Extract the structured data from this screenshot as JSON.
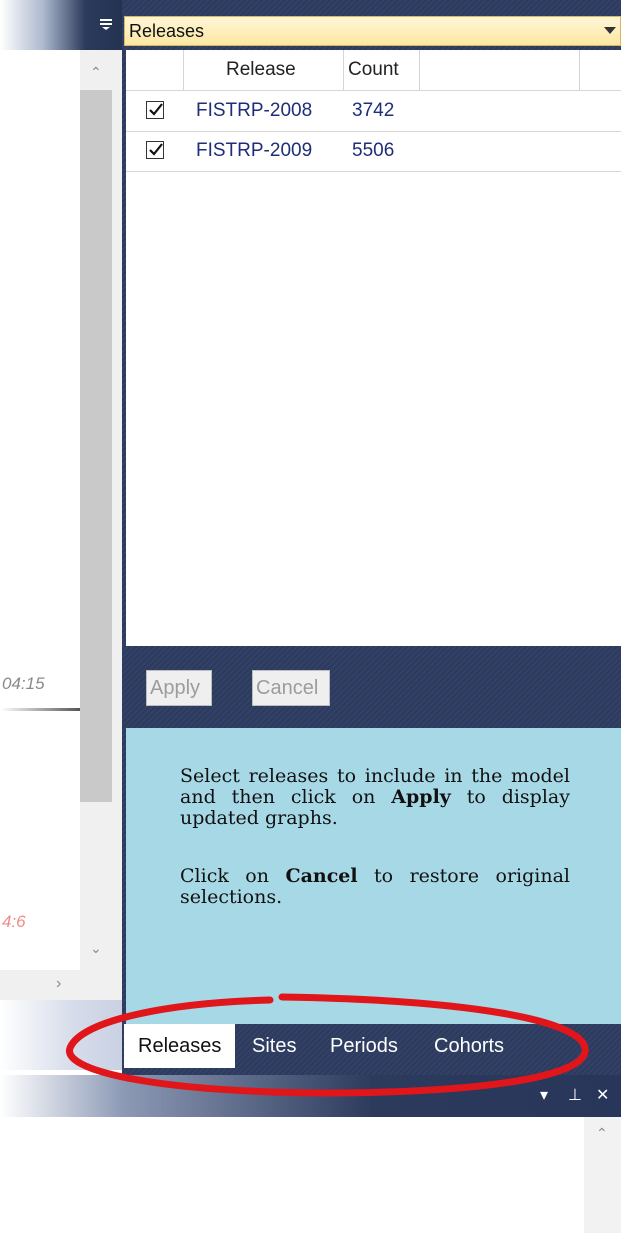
{
  "left": {
    "time_fragment_1": "04:15",
    "time_fragment_2": "4:6"
  },
  "panel": {
    "dropdown_value": "Releases",
    "grid": {
      "columns": [
        "Release",
        "Count"
      ],
      "rows": [
        {
          "checked": true,
          "release": "FISTRP-2008",
          "count": "3742"
        },
        {
          "checked": true,
          "release": "FISTRP-2009",
          "count": "5506"
        }
      ]
    },
    "buttons": {
      "apply": "Apply",
      "cancel": "Cancel"
    },
    "help": {
      "p1_text": "Select releases to include in the model and then click on ",
      "p1_bold": "Apply",
      "p1_tail": " to display updated graphs.",
      "p2_head": "Click on ",
      "p2_bold": "Cancel",
      "p2_tail": " to restore original selections."
    },
    "tabs": [
      "Releases",
      "Sites",
      "Periods",
      "Cohorts"
    ],
    "active_tab": "Releases"
  },
  "colors": {
    "panel_bg": "#2b3a5e",
    "dropdown_bg": "#fde7a2",
    "help_bg": "#a7d8e6",
    "link_text": "#1f2d7a",
    "highlight_ellipse": "#e0161b"
  },
  "icons": [
    "menu-icon",
    "dropdown-caret-icon",
    "checkmark-icon",
    "scroll-up-icon",
    "scroll-down-icon",
    "scroll-right-icon",
    "pin-icon",
    "close-icon",
    "window-menu-icon"
  ]
}
